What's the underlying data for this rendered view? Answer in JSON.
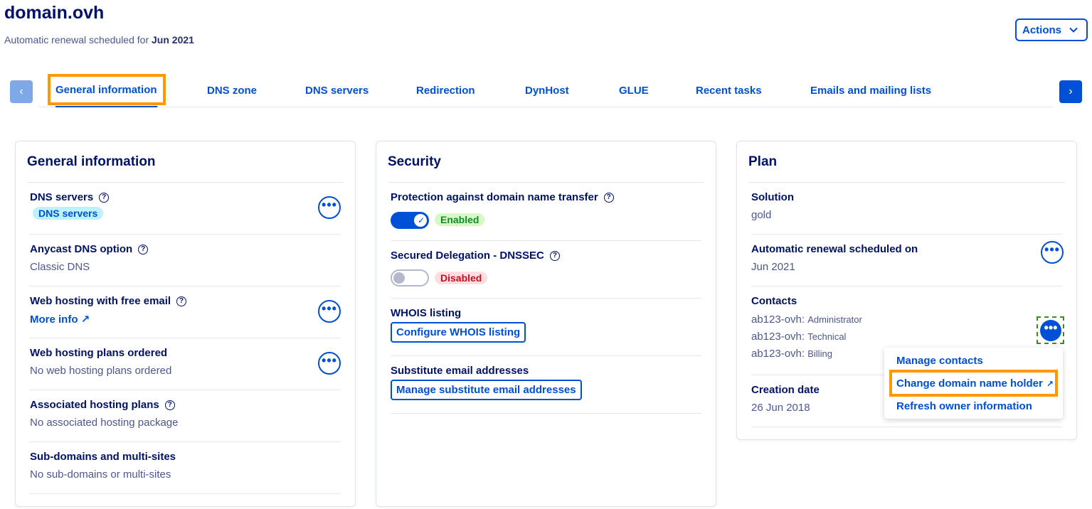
{
  "header": {
    "title": "domain.ovh",
    "subtitle_prefix": "Automatic renewal scheduled for ",
    "subtitle_date": "Jun 2021",
    "actions_label": "Actions"
  },
  "tabs": [
    {
      "label": "General information",
      "active": true
    },
    {
      "label": "DNS zone"
    },
    {
      "label": "DNS servers"
    },
    {
      "label": "Redirection"
    },
    {
      "label": "DynHost"
    },
    {
      "label": "GLUE"
    },
    {
      "label": "Recent tasks"
    },
    {
      "label": "Emails and mailing lists"
    }
  ],
  "general": {
    "title": "General information",
    "rows": [
      {
        "label": "DNS servers",
        "value": "DNS servers"
      },
      {
        "label": "Anycast DNS option",
        "value": "Classic DNS"
      },
      {
        "label": "Web hosting with free email",
        "value": "More info"
      },
      {
        "label": "Web hosting plans ordered",
        "value": "No web hosting plans ordered"
      },
      {
        "label": "Associated hosting plans",
        "value": "No associated hosting package"
      },
      {
        "label": "Sub-domains and multi-sites",
        "value": "No sub-domains or multi-sites"
      }
    ]
  },
  "security": {
    "title": "Security",
    "transfer_label": "Protection against domain name transfer",
    "transfer_status": "Enabled",
    "dnssec_label": "Secured Delegation - DNSSEC",
    "dnssec_status": "Disabled",
    "whois_label": "WHOIS listing",
    "whois_button": "Configure WHOIS listing",
    "subst_label": "Substitute email addresses",
    "subst_button": "Manage substitute email addresses"
  },
  "plan": {
    "title": "Plan",
    "solution_label": "Solution",
    "solution_value": "gold",
    "renewal_label": "Automatic renewal scheduled on",
    "renewal_value": "Jun 2021",
    "contacts_label": "Contacts",
    "contacts": [
      {
        "id": "ab123-ovh:",
        "role": "Administrator"
      },
      {
        "id": "ab123-ovh:",
        "role": "Technical"
      },
      {
        "id": "ab123-ovh:",
        "role": "Billing"
      }
    ],
    "creation_label": "Creation date",
    "creation_value": "26 Jun 2018"
  },
  "contacts_menu": {
    "items": [
      "Manage contacts",
      "Change domain name holder",
      "Refresh owner information"
    ]
  },
  "colors": {
    "accent": "#0050d7",
    "highlight": "#ff9803",
    "title": "#01116b"
  }
}
